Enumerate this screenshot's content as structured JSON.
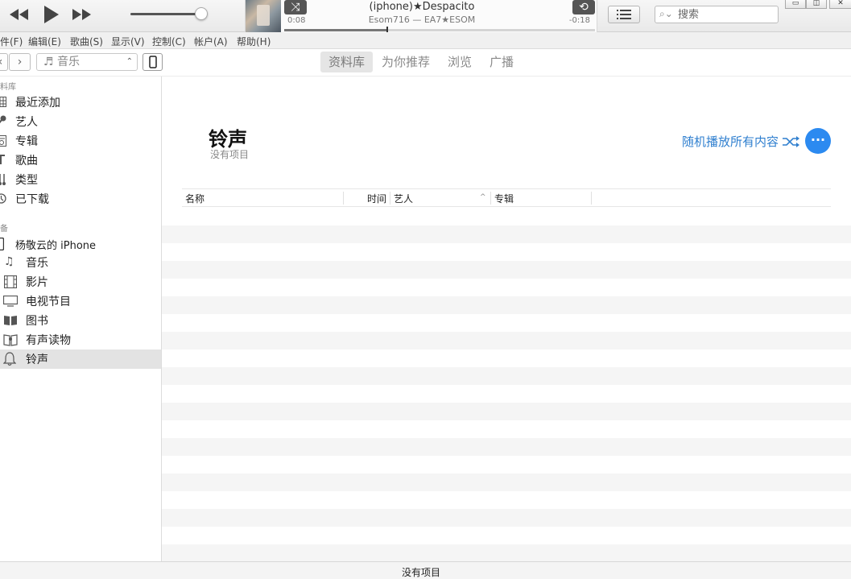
{
  "player": {
    "now_playing": {
      "title": "(iphone)★Despacito",
      "artist_album": "Esom716 — EA7★ESOM",
      "elapsed": "0:08",
      "remaining": "-0:18",
      "progress_fraction": 0.33
    },
    "volume_fraction": 0.92,
    "search_placeholder": "搜索"
  },
  "menu": [
    "件(F)",
    "编辑(E)",
    "歌曲(S)",
    "显示(V)",
    "控制(C)",
    "帐户(A)",
    "帮助(H)"
  ],
  "toolbar": {
    "media_kind": "音乐",
    "media_icon": "♬",
    "tabs": [
      "资料库",
      "为你推荐",
      "浏览",
      "广播"
    ],
    "active_tab_index": 0
  },
  "sidebar": {
    "library_heading": "料库",
    "library_items": [
      {
        "label": "最近添加",
        "icon": "grid-icon"
      },
      {
        "label": "艺人",
        "icon": "microphone-icon"
      },
      {
        "label": "专辑",
        "icon": "album-icon"
      },
      {
        "label": "歌曲",
        "icon": "note-icon"
      },
      {
        "label": "类型",
        "icon": "genre-icon"
      },
      {
        "label": "已下载",
        "icon": "download-icon"
      }
    ],
    "devices_heading": "备",
    "device_name": "杨敬云的 iPhone",
    "device_items": [
      {
        "label": "音乐",
        "icon": "music-icon"
      },
      {
        "label": "影片",
        "icon": "film-icon"
      },
      {
        "label": "电视节目",
        "icon": "tv-icon"
      },
      {
        "label": "图书",
        "icon": "book-icon"
      },
      {
        "label": "有声读物",
        "icon": "audiobook-icon"
      },
      {
        "label": "铃声",
        "icon": "bell-icon"
      }
    ],
    "selected_device_item_index": 5
  },
  "main": {
    "title": "铃声",
    "subtitle": "没有项目",
    "shuffle_all_label": "随机播放所有内容",
    "more_label": "···",
    "columns": [
      "名称",
      "时间",
      "艺人",
      "专辑"
    ],
    "sorted_column_index": 2
  },
  "status": {
    "text": "没有项目"
  },
  "colors": {
    "accent": "#2c8af0",
    "link": "#2f7fcf",
    "selected_row": "#e3e3e3",
    "stripe": "#f5f5f5"
  }
}
